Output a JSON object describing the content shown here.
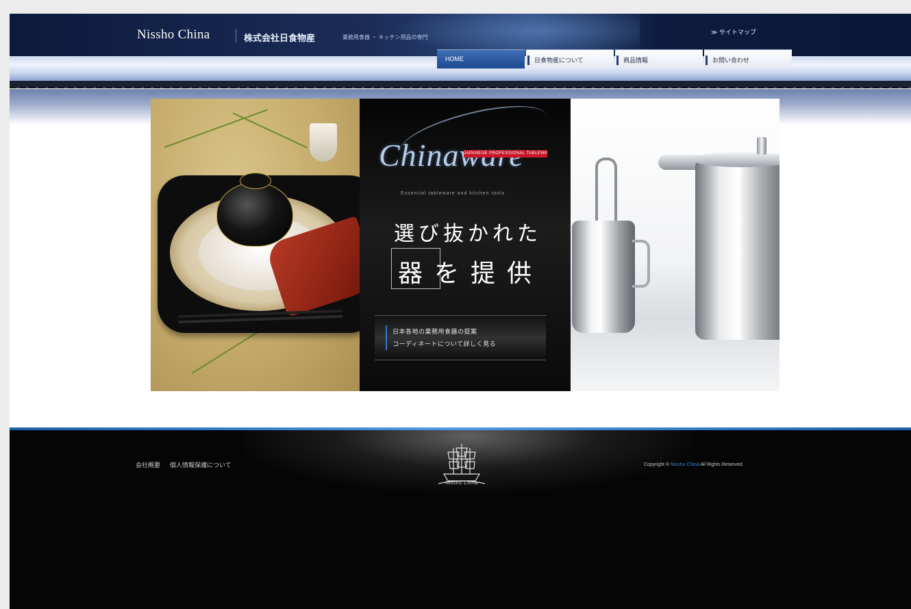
{
  "header": {
    "brand": "Nissho China",
    "subbrand": "株式会社日食物産",
    "tagline": "業務用食器 ・ キッチン用品の専門",
    "sitemap_link": "≫ サイトマップ"
  },
  "nav": {
    "tabs": [
      {
        "label": "HOME",
        "active": true
      },
      {
        "label": "日食物産について",
        "active": false
      },
      {
        "label": "商品情報",
        "active": false
      },
      {
        "label": "お問い合わせ",
        "active": false
      }
    ]
  },
  "hero": {
    "ribbon": "JAPANESE PROFESSIONAL TABLEWARE",
    "logo_text": "Chinaware",
    "caption": "Essential tableware and kitchen tools",
    "headline_1": "選び抜かれた",
    "headline_2": "器 を 提 供",
    "info_lines": [
      "日本各地の業務用食器の提案",
      "コーディネートについて詳しく見る"
    ]
  },
  "footer": {
    "links": [
      "会社概要",
      "個人情報保護について"
    ],
    "logo_caption": "Nissho China",
    "copyright_prefix": "Copyright ©",
    "copyright_name": "Nissho China",
    "copyright_suffix": " All Rights Reserved."
  },
  "colors": {
    "header_navy": "#0c1a3a",
    "active_tab": "#1d4a8f",
    "footer_accent": "#3a86d6",
    "ribbon_red": "#c8182a"
  }
}
